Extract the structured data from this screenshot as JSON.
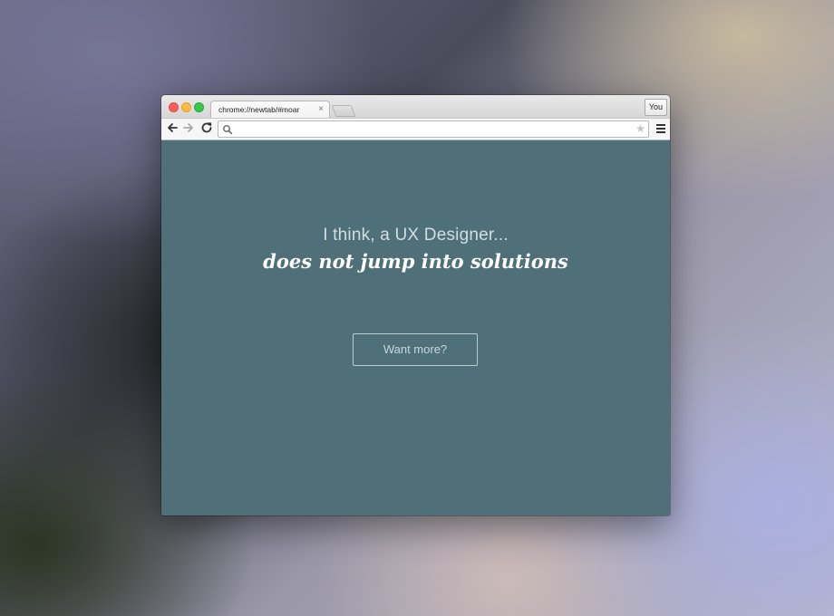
{
  "browser": {
    "tab": {
      "title": "chrome://newtab/#moar",
      "close_glyph": "×"
    },
    "profile_label": "You",
    "omnibox": {
      "value": "",
      "placeholder": ""
    },
    "icons": {
      "back": "arrow-left-icon",
      "forward": "arrow-right-icon",
      "reload": "reload-icon",
      "search": "search-icon",
      "star": "star-icon",
      "menu": "hamburger-menu-icon"
    }
  },
  "page": {
    "line1": "I think, a UX Designer...",
    "line2": "does not jump into solutions",
    "cta_label": "Want more?",
    "background_color": "#4f6f79"
  }
}
